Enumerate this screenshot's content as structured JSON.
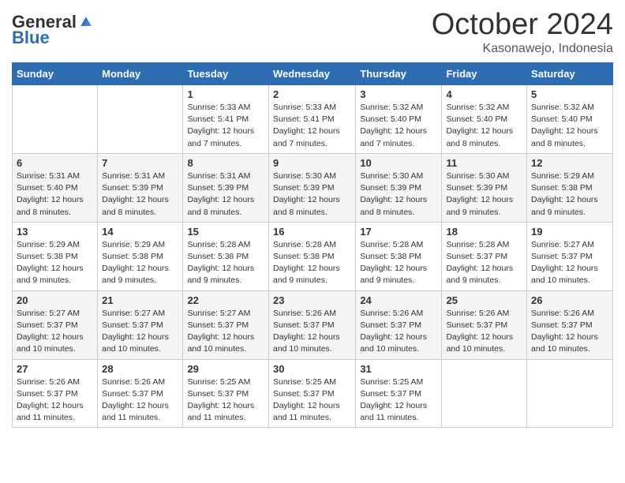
{
  "logo": {
    "general": "General",
    "blue": "Blue"
  },
  "header": {
    "month": "October 2024",
    "location": "Kasonawejo, Indonesia"
  },
  "weekdays": [
    "Sunday",
    "Monday",
    "Tuesday",
    "Wednesday",
    "Thursday",
    "Friday",
    "Saturday"
  ],
  "weeks": [
    [
      null,
      null,
      {
        "day": 1,
        "sunrise": "5:33 AM",
        "sunset": "5:41 PM",
        "daylight": "12 hours and 7 minutes."
      },
      {
        "day": 2,
        "sunrise": "5:33 AM",
        "sunset": "5:41 PM",
        "daylight": "12 hours and 7 minutes."
      },
      {
        "day": 3,
        "sunrise": "5:32 AM",
        "sunset": "5:40 PM",
        "daylight": "12 hours and 7 minutes."
      },
      {
        "day": 4,
        "sunrise": "5:32 AM",
        "sunset": "5:40 PM",
        "daylight": "12 hours and 8 minutes."
      },
      {
        "day": 5,
        "sunrise": "5:32 AM",
        "sunset": "5:40 PM",
        "daylight": "12 hours and 8 minutes."
      }
    ],
    [
      {
        "day": 6,
        "sunrise": "5:31 AM",
        "sunset": "5:40 PM",
        "daylight": "12 hours and 8 minutes."
      },
      {
        "day": 7,
        "sunrise": "5:31 AM",
        "sunset": "5:39 PM",
        "daylight": "12 hours and 8 minutes."
      },
      {
        "day": 8,
        "sunrise": "5:31 AM",
        "sunset": "5:39 PM",
        "daylight": "12 hours and 8 minutes."
      },
      {
        "day": 9,
        "sunrise": "5:30 AM",
        "sunset": "5:39 PM",
        "daylight": "12 hours and 8 minutes."
      },
      {
        "day": 10,
        "sunrise": "5:30 AM",
        "sunset": "5:39 PM",
        "daylight": "12 hours and 8 minutes."
      },
      {
        "day": 11,
        "sunrise": "5:30 AM",
        "sunset": "5:39 PM",
        "daylight": "12 hours and 9 minutes."
      },
      {
        "day": 12,
        "sunrise": "5:29 AM",
        "sunset": "5:38 PM",
        "daylight": "12 hours and 9 minutes."
      }
    ],
    [
      {
        "day": 13,
        "sunrise": "5:29 AM",
        "sunset": "5:38 PM",
        "daylight": "12 hours and 9 minutes."
      },
      {
        "day": 14,
        "sunrise": "5:29 AM",
        "sunset": "5:38 PM",
        "daylight": "12 hours and 9 minutes."
      },
      {
        "day": 15,
        "sunrise": "5:28 AM",
        "sunset": "5:38 PM",
        "daylight": "12 hours and 9 minutes."
      },
      {
        "day": 16,
        "sunrise": "5:28 AM",
        "sunset": "5:38 PM",
        "daylight": "12 hours and 9 minutes."
      },
      {
        "day": 17,
        "sunrise": "5:28 AM",
        "sunset": "5:38 PM",
        "daylight": "12 hours and 9 minutes."
      },
      {
        "day": 18,
        "sunrise": "5:28 AM",
        "sunset": "5:37 PM",
        "daylight": "12 hours and 9 minutes."
      },
      {
        "day": 19,
        "sunrise": "5:27 AM",
        "sunset": "5:37 PM",
        "daylight": "12 hours and 10 minutes."
      }
    ],
    [
      {
        "day": 20,
        "sunrise": "5:27 AM",
        "sunset": "5:37 PM",
        "daylight": "12 hours and 10 minutes."
      },
      {
        "day": 21,
        "sunrise": "5:27 AM",
        "sunset": "5:37 PM",
        "daylight": "12 hours and 10 minutes."
      },
      {
        "day": 22,
        "sunrise": "5:27 AM",
        "sunset": "5:37 PM",
        "daylight": "12 hours and 10 minutes."
      },
      {
        "day": 23,
        "sunrise": "5:26 AM",
        "sunset": "5:37 PM",
        "daylight": "12 hours and 10 minutes."
      },
      {
        "day": 24,
        "sunrise": "5:26 AM",
        "sunset": "5:37 PM",
        "daylight": "12 hours and 10 minutes."
      },
      {
        "day": 25,
        "sunrise": "5:26 AM",
        "sunset": "5:37 PM",
        "daylight": "12 hours and 10 minutes."
      },
      {
        "day": 26,
        "sunrise": "5:26 AM",
        "sunset": "5:37 PM",
        "daylight": "12 hours and 10 minutes."
      }
    ],
    [
      {
        "day": 27,
        "sunrise": "5:26 AM",
        "sunset": "5:37 PM",
        "daylight": "12 hours and 11 minutes."
      },
      {
        "day": 28,
        "sunrise": "5:26 AM",
        "sunset": "5:37 PM",
        "daylight": "12 hours and 11 minutes."
      },
      {
        "day": 29,
        "sunrise": "5:25 AM",
        "sunset": "5:37 PM",
        "daylight": "12 hours and 11 minutes."
      },
      {
        "day": 30,
        "sunrise": "5:25 AM",
        "sunset": "5:37 PM",
        "daylight": "12 hours and 11 minutes."
      },
      {
        "day": 31,
        "sunrise": "5:25 AM",
        "sunset": "5:37 PM",
        "daylight": "12 hours and 11 minutes."
      },
      null,
      null
    ]
  ],
  "labels": {
    "sunrise": "Sunrise:",
    "sunset": "Sunset:",
    "daylight": "Daylight:"
  }
}
